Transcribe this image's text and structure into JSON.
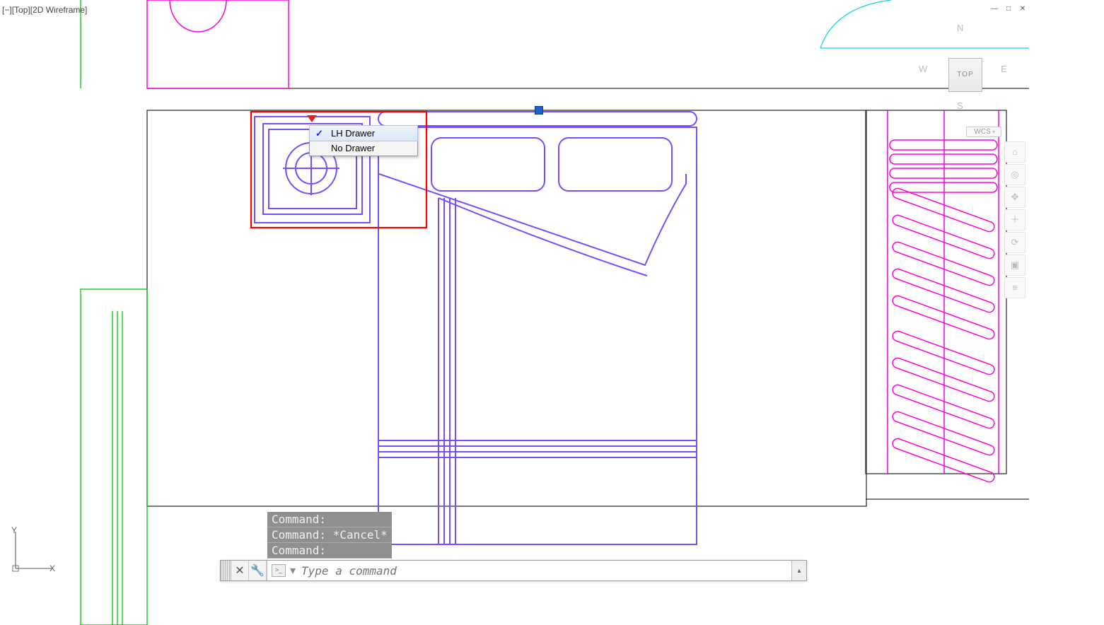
{
  "viewport": {
    "bracket1": "[−]",
    "view": "[Top]",
    "style": "[2D Wireframe]"
  },
  "window_controls": {
    "min": "—",
    "restore": "□",
    "close": "✕"
  },
  "viewcube": {
    "n": "N",
    "e": "E",
    "s": "S",
    "w": "W",
    "top": "TOP",
    "wcs": "WCS"
  },
  "navbar_icons": [
    "home-icon",
    "wheel-icon",
    "pan-icon",
    "zoom-icon",
    "orbit-icon",
    "showmotion-icon",
    "menu-icon"
  ],
  "context_menu": {
    "items": [
      {
        "label": "LH Drawer",
        "checked": true,
        "selected": true
      },
      {
        "label": "No Drawer",
        "checked": false,
        "selected": false
      }
    ]
  },
  "command_history": [
    "Command:",
    "Command: *Cancel*",
    "Command:"
  ],
  "command_input": {
    "placeholder": "Type a command"
  },
  "ucs": {
    "x": "X",
    "y": "Y"
  },
  "colors": {
    "violet": "#7a4cff",
    "magenta": "#ff00d8",
    "green": "#00c800",
    "red": "#ff0000",
    "black": "#333333",
    "cyan": "#17d4e6"
  }
}
